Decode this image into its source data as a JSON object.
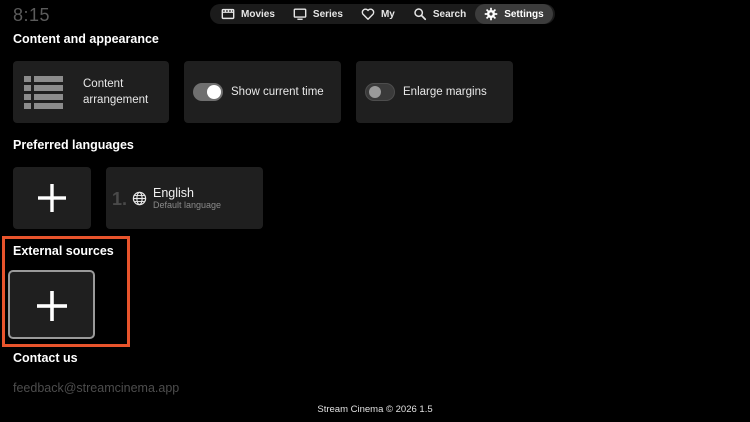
{
  "clock": "8:15",
  "nav": {
    "items": [
      {
        "label": "Movies",
        "icon": "film-icon"
      },
      {
        "label": "Series",
        "icon": "tv-icon"
      },
      {
        "label": "My",
        "icon": "heart-icon"
      },
      {
        "label": "Search",
        "icon": "search-icon"
      },
      {
        "label": "Settings",
        "icon": "gear-icon",
        "active": true
      }
    ]
  },
  "content_appearance": {
    "title": "Content and appearance",
    "content_arrangement": "Content arrangement",
    "show_current_time": {
      "label": "Show current time",
      "on": true
    },
    "enlarge_margins": {
      "label": "Enlarge margins",
      "on": false
    }
  },
  "preferred_languages": {
    "title": "Preferred languages",
    "languages": [
      {
        "index": "1.",
        "name": "English",
        "subtitle": "Default language"
      }
    ]
  },
  "external_sources": {
    "title": "External sources"
  },
  "contact": {
    "title": "Contact us",
    "email": "feedback@streamcinema.app"
  },
  "footer": "Stream Cinema © 2026 1.5",
  "colors": {
    "highlight": "#e8542c",
    "card": "#1f1f1f",
    "background": "#000000"
  }
}
